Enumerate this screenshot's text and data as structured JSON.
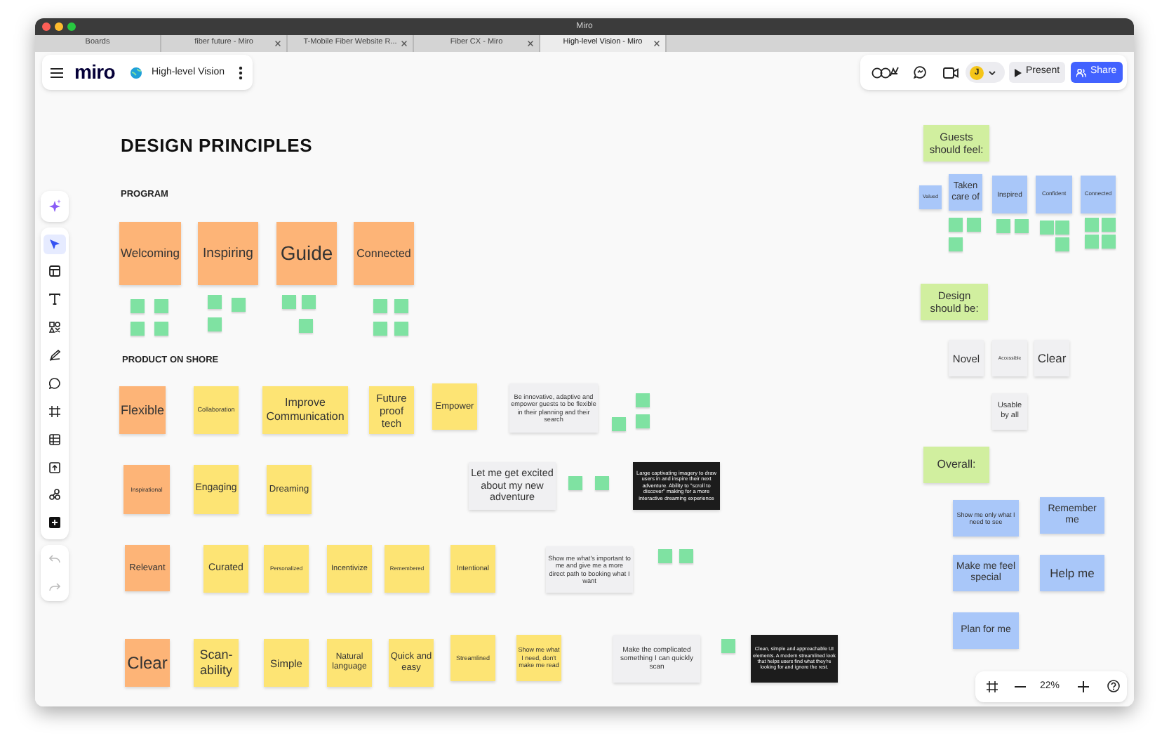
{
  "window": {
    "title": "Miro"
  },
  "tabs": [
    {
      "label": "Boards",
      "selected": false,
      "closable": false
    },
    {
      "label": "fiber future - Miro",
      "selected": false,
      "closable": true
    },
    {
      "label": "T-Mobile Fiber Website R...",
      "selected": false,
      "closable": true
    },
    {
      "label": "Fiber CX - Miro",
      "selected": false,
      "closable": true
    },
    {
      "label": "High-level Vision - Miro",
      "selected": true,
      "closable": true
    }
  ],
  "board": {
    "logo": "miro",
    "name": "High-level Vision"
  },
  "toolbar": {
    "avatar": "J",
    "present": "Present",
    "share": "Share"
  },
  "canvas": {
    "heading": "DESIGN PRINCIPLES",
    "sections": [
      "PROGRAM",
      "PRODUCT ON SHORE"
    ]
  },
  "notes": [
    {
      "text": "Welcoming",
      "kind": "orange"
    },
    {
      "text": "Inspiring",
      "kind": "orange"
    },
    {
      "text": "Guide",
      "kind": "orange"
    },
    {
      "text": "Connected",
      "kind": "orange"
    },
    {
      "text": "Flexible",
      "kind": "orange"
    },
    {
      "text": "Collaboration",
      "kind": "yellow"
    },
    {
      "text": "Improve Communication",
      "kind": "yellow"
    },
    {
      "text": "Future proof tech",
      "kind": "yellow"
    },
    {
      "text": "Empower",
      "kind": "yellow"
    },
    {
      "text": "Be innovative, adaptive and empower guests to be flexible in their planning and their search",
      "kind": "gray"
    },
    {
      "text": "Inspirational",
      "kind": "orange"
    },
    {
      "text": "Engaging",
      "kind": "yellow"
    },
    {
      "text": "Dreaming",
      "kind": "yellow"
    },
    {
      "text": "Let me get excited about my new adventure",
      "kind": "gray"
    },
    {
      "text": "Large captivating imagery to draw users in and inspire their next adventure. Ability to \"scroll to discover\" making for a more interactive dreaming experience",
      "kind": "dark"
    },
    {
      "text": "Relevant",
      "kind": "orange"
    },
    {
      "text": "Curated",
      "kind": "yellow"
    },
    {
      "text": "Personalized",
      "kind": "yellow"
    },
    {
      "text": "Incentivize",
      "kind": "yellow"
    },
    {
      "text": "Remembered",
      "kind": "yellow"
    },
    {
      "text": "Intentional",
      "kind": "yellow"
    },
    {
      "text": "Show me what's important to me and give me a more direct path to booking what I want",
      "kind": "gray"
    },
    {
      "text": "Clear",
      "kind": "orange"
    },
    {
      "text": "Scan-ability",
      "kind": "yellow"
    },
    {
      "text": "Simple",
      "kind": "yellow"
    },
    {
      "text": "Natural language",
      "kind": "yellow"
    },
    {
      "text": "Quick and easy",
      "kind": "yellow"
    },
    {
      "text": "Streamlined",
      "kind": "yellow"
    },
    {
      "text": "Show me what I need, don't make me read",
      "kind": "yellow"
    },
    {
      "text": "Make the complicated something I can quickly scan",
      "kind": "gray"
    },
    {
      "text": "Clean, simple and approachable UI elements. A modern streamlined look that helps users find what they're looking for and ignore the rest.",
      "kind": "dark"
    },
    {
      "text": "Guests should feel:",
      "kind": "lime"
    },
    {
      "text": "Valued",
      "kind": "blue"
    },
    {
      "text": "Taken care of",
      "kind": "blue"
    },
    {
      "text": "Inspired",
      "kind": "blue"
    },
    {
      "text": "Confident",
      "kind": "blue"
    },
    {
      "text": "Connected",
      "kind": "blue"
    },
    {
      "text": "Design should be:",
      "kind": "lime"
    },
    {
      "text": "Novel",
      "kind": "gray"
    },
    {
      "text": "Accessible",
      "kind": "gray"
    },
    {
      "text": "Clear",
      "kind": "gray"
    },
    {
      "text": "Usable by all",
      "kind": "gray"
    },
    {
      "text": "Overall:",
      "kind": "lime"
    },
    {
      "text": "Show me only what I need to see",
      "kind": "blue"
    },
    {
      "text": "Remember me",
      "kind": "blue"
    },
    {
      "text": "Make me feel special",
      "kind": "blue"
    },
    {
      "text": "Help me",
      "kind": "blue"
    },
    {
      "text": "Plan for me",
      "kind": "blue"
    }
  ],
  "zoom": {
    "reading": "22%"
  }
}
